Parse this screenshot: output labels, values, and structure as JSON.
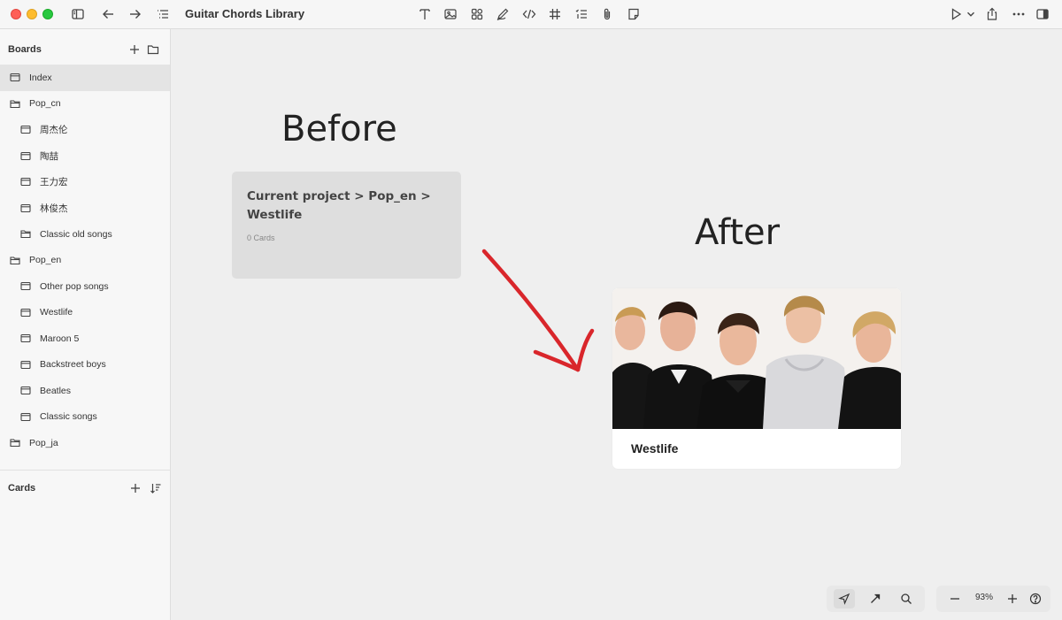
{
  "window": {
    "title": "Guitar Chords Library"
  },
  "sidebar": {
    "boards_header": "Boards",
    "cards_header": "Cards",
    "boards": [
      {
        "label": "Index",
        "kind": "board",
        "level": 0,
        "selected": true
      },
      {
        "label": "Pop_cn",
        "kind": "folder",
        "level": 0
      },
      {
        "label": "周杰伦",
        "kind": "board",
        "level": 1
      },
      {
        "label": "陶喆",
        "kind": "board",
        "level": 1
      },
      {
        "label": "王力宏",
        "kind": "board",
        "level": 1
      },
      {
        "label": "林俊杰",
        "kind": "board",
        "level": 1
      },
      {
        "label": "Classic old songs",
        "kind": "folder",
        "level": 1
      },
      {
        "label": "Pop_en",
        "kind": "folder",
        "level": 0
      },
      {
        "label": "Other pop songs",
        "kind": "board",
        "level": 1
      },
      {
        "label": "Westlife",
        "kind": "board",
        "level": 1
      },
      {
        "label": "Maroon 5",
        "kind": "board",
        "level": 1
      },
      {
        "label": "Backstreet boys",
        "kind": "board",
        "level": 1
      },
      {
        "label": "Beatles",
        "kind": "board",
        "level": 1
      },
      {
        "label": "Classic songs",
        "kind": "board",
        "level": 1
      },
      {
        "label": "Pop_ja",
        "kind": "folder",
        "level": 0
      }
    ]
  },
  "canvas": {
    "before_label": "Before",
    "after_label": "After",
    "before_card": {
      "title": "Current project > Pop_en > Westlife",
      "count": "0 Cards"
    },
    "after_card": {
      "title": "Westlife"
    },
    "arrow_color": "#d9262b"
  },
  "bottom_bar": {
    "zoom": "93%"
  },
  "icons": [
    "sidebar-toggle-icon",
    "back-arrow-icon",
    "forward-arrow-icon",
    "outline-icon",
    "text-icon",
    "image-icon",
    "components-icon",
    "pen-icon",
    "code-icon",
    "grid-icon",
    "checklist-icon",
    "attachment-icon",
    "sticky-note-icon",
    "play-icon",
    "chevron-down-icon",
    "share-icon",
    "more-icon",
    "inspector-icon",
    "plus-icon",
    "folder-icon",
    "sort-icon",
    "pointer-icon",
    "connector-arrow-icon",
    "search-icon",
    "minus-icon",
    "help-icon"
  ]
}
